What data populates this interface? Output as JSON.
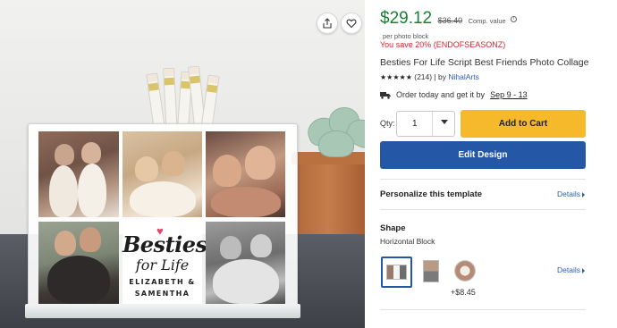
{
  "product_image": {
    "alt": "Besties For Life Script Best Friends Photo Collage",
    "collage_script_line1": "Besties",
    "collage_script_line2": "for Life",
    "collage_names_line1": "ELIZABETH &",
    "collage_names_line2": "SAMENTHA",
    "share_icon": "share-icon",
    "favorite_icon": "heart-outline-icon"
  },
  "pricing": {
    "price": "$29.12",
    "compare_price": "$36.40",
    "compare_label": "Comp. value",
    "unit_note": "per photo block",
    "savings_text": "You save 20% (ENDOFSEASONZ)",
    "price_color": "#1a7e36",
    "savings_color": "#d0262d"
  },
  "product": {
    "title": "Besties For Life Script Best Friends Photo Collage",
    "stars": "★★★★★",
    "review_count": "(214)",
    "by_label": "| by",
    "seller": "NihalArts"
  },
  "delivery": {
    "icon": "truck-icon",
    "text": "Order today and get it by",
    "dates": "Sep 9 - 13"
  },
  "purchase": {
    "qty_label": "Qty:",
    "qty_value": "1",
    "add_to_cart": "Add to Cart",
    "edit_design": "Edit Design",
    "cart_color": "#f6b92b",
    "edit_color": "#2557a7"
  },
  "personalize": {
    "title": "Personalize this template",
    "details_link": "Details"
  },
  "shape": {
    "title": "Shape",
    "selected": "Horizontal Block",
    "details_link": "Details",
    "options": [
      {
        "name": "Horizontal Block",
        "selected": true,
        "price_addon": ""
      },
      {
        "name": "Vertical Block",
        "selected": false,
        "price_addon": ""
      },
      {
        "name": "Round",
        "selected": false,
        "price_addon": "+$8.45"
      }
    ]
  }
}
